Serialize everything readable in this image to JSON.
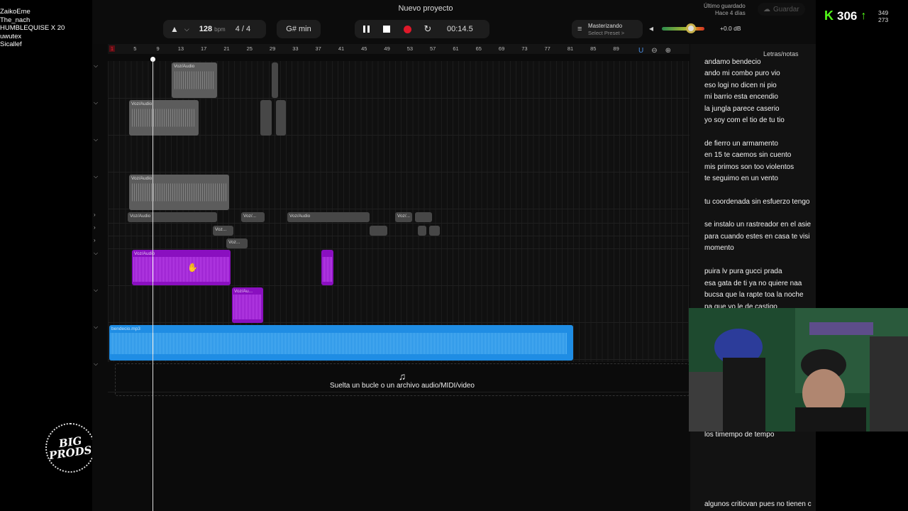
{
  "stream": {
    "names": [
      "ZaikoEme",
      "The_nach",
      "HUMBLEQUISE X 20",
      "uwutex",
      "Sicallef"
    ],
    "logo_text": [
      "BIG",
      "PRODS"
    ],
    "kick_count": "306",
    "kick_stats": [
      "349",
      "273"
    ]
  },
  "header": {
    "project_title": "Nuevo proyecto",
    "tempo": "128",
    "tempo_unit": "bpm",
    "time_signature": "4 / 4",
    "key": "G# min",
    "time": "00:14.5",
    "master_title": "Masterizando",
    "master_preset": "Select Preset >",
    "volume_db": "+0.0 dB",
    "volume_level": 0.72,
    "saved_label": "Último guardado",
    "saved_time": "Hace 4 días",
    "save_button": "Guardar"
  },
  "ruler": {
    "marks": [
      "1",
      "5",
      "9",
      "13",
      "17",
      "21",
      "25",
      "29",
      "33",
      "37",
      "41",
      "45",
      "49",
      "53",
      "57",
      "61",
      "65",
      "69",
      "73",
      "77",
      "81",
      "85",
      "89"
    ]
  },
  "clips": [
    {
      "label": "Voz/Audio",
      "type": "gray"
    },
    {
      "label": "",
      "type": "graysm"
    },
    {
      "label": "Voz/Audio",
      "type": "gray"
    },
    {
      "label": "",
      "type": "graysm"
    },
    {
      "label": "",
      "type": "graysm"
    },
    {
      "label": "Voz/Audio",
      "type": "gray"
    },
    {
      "label": "Voz/Audio",
      "type": "graysm"
    },
    {
      "label": "Voz/...",
      "type": "graysm"
    },
    {
      "label": "Voz/Audio",
      "type": "graysm"
    },
    {
      "label": "Voz/...",
      "type": "graysm"
    },
    {
      "label": "Voz...",
      "type": "graysm"
    },
    {
      "label": "Voz...",
      "type": "graysm"
    },
    {
      "label": "",
      "type": "graysm"
    },
    {
      "label": "",
      "type": "graysm"
    },
    {
      "label": "",
      "type": "graysm"
    },
    {
      "label": "",
      "type": "graysm"
    },
    {
      "label": "Voz/Audio",
      "type": "purple"
    },
    {
      "label": "",
      "type": "purple"
    },
    {
      "label": "Voz/Au...",
      "type": "purple"
    },
    {
      "label": "bendecio.mp3",
      "type": "blue"
    }
  ],
  "drop_zone_text": "Suelta un bucle o un archivo audio/MIDI/video",
  "lyrics": {
    "title": "Letras/notas",
    "lines": [
      "andamo bendecio",
      "ando mi combo puro vio",
      "eso logi no dicen ni pio",
      "mi barrio esta encendio",
      "la jungla parece caserio",
      "yo soy com el tio de tu tio",
      "de fierro un armamento",
      "en 15 te  caemos sin cuento",
      "mis primos son too violentos",
      "te seguimo en un vento",
      "tu coordenada sin esfuerzo tengo",
      "se instalo un rastreador en el asie",
      "para cuando estes en casa te visi",
      "momento",
      "puira lv pura gucci prada",
      "esa gata de ti ya no quiere naa",
      "bucsa que la rapte toa la noche",
      "pa que yo le de castigo",
      "los timempo de tempo",
      "algunos criticvan pues no tienen c"
    ]
  },
  "colors": {
    "record": "#e0192a",
    "purple_clip": "#8a0fc0",
    "blue_clip": "#1f8de4",
    "kick_green": "#53fc18"
  }
}
